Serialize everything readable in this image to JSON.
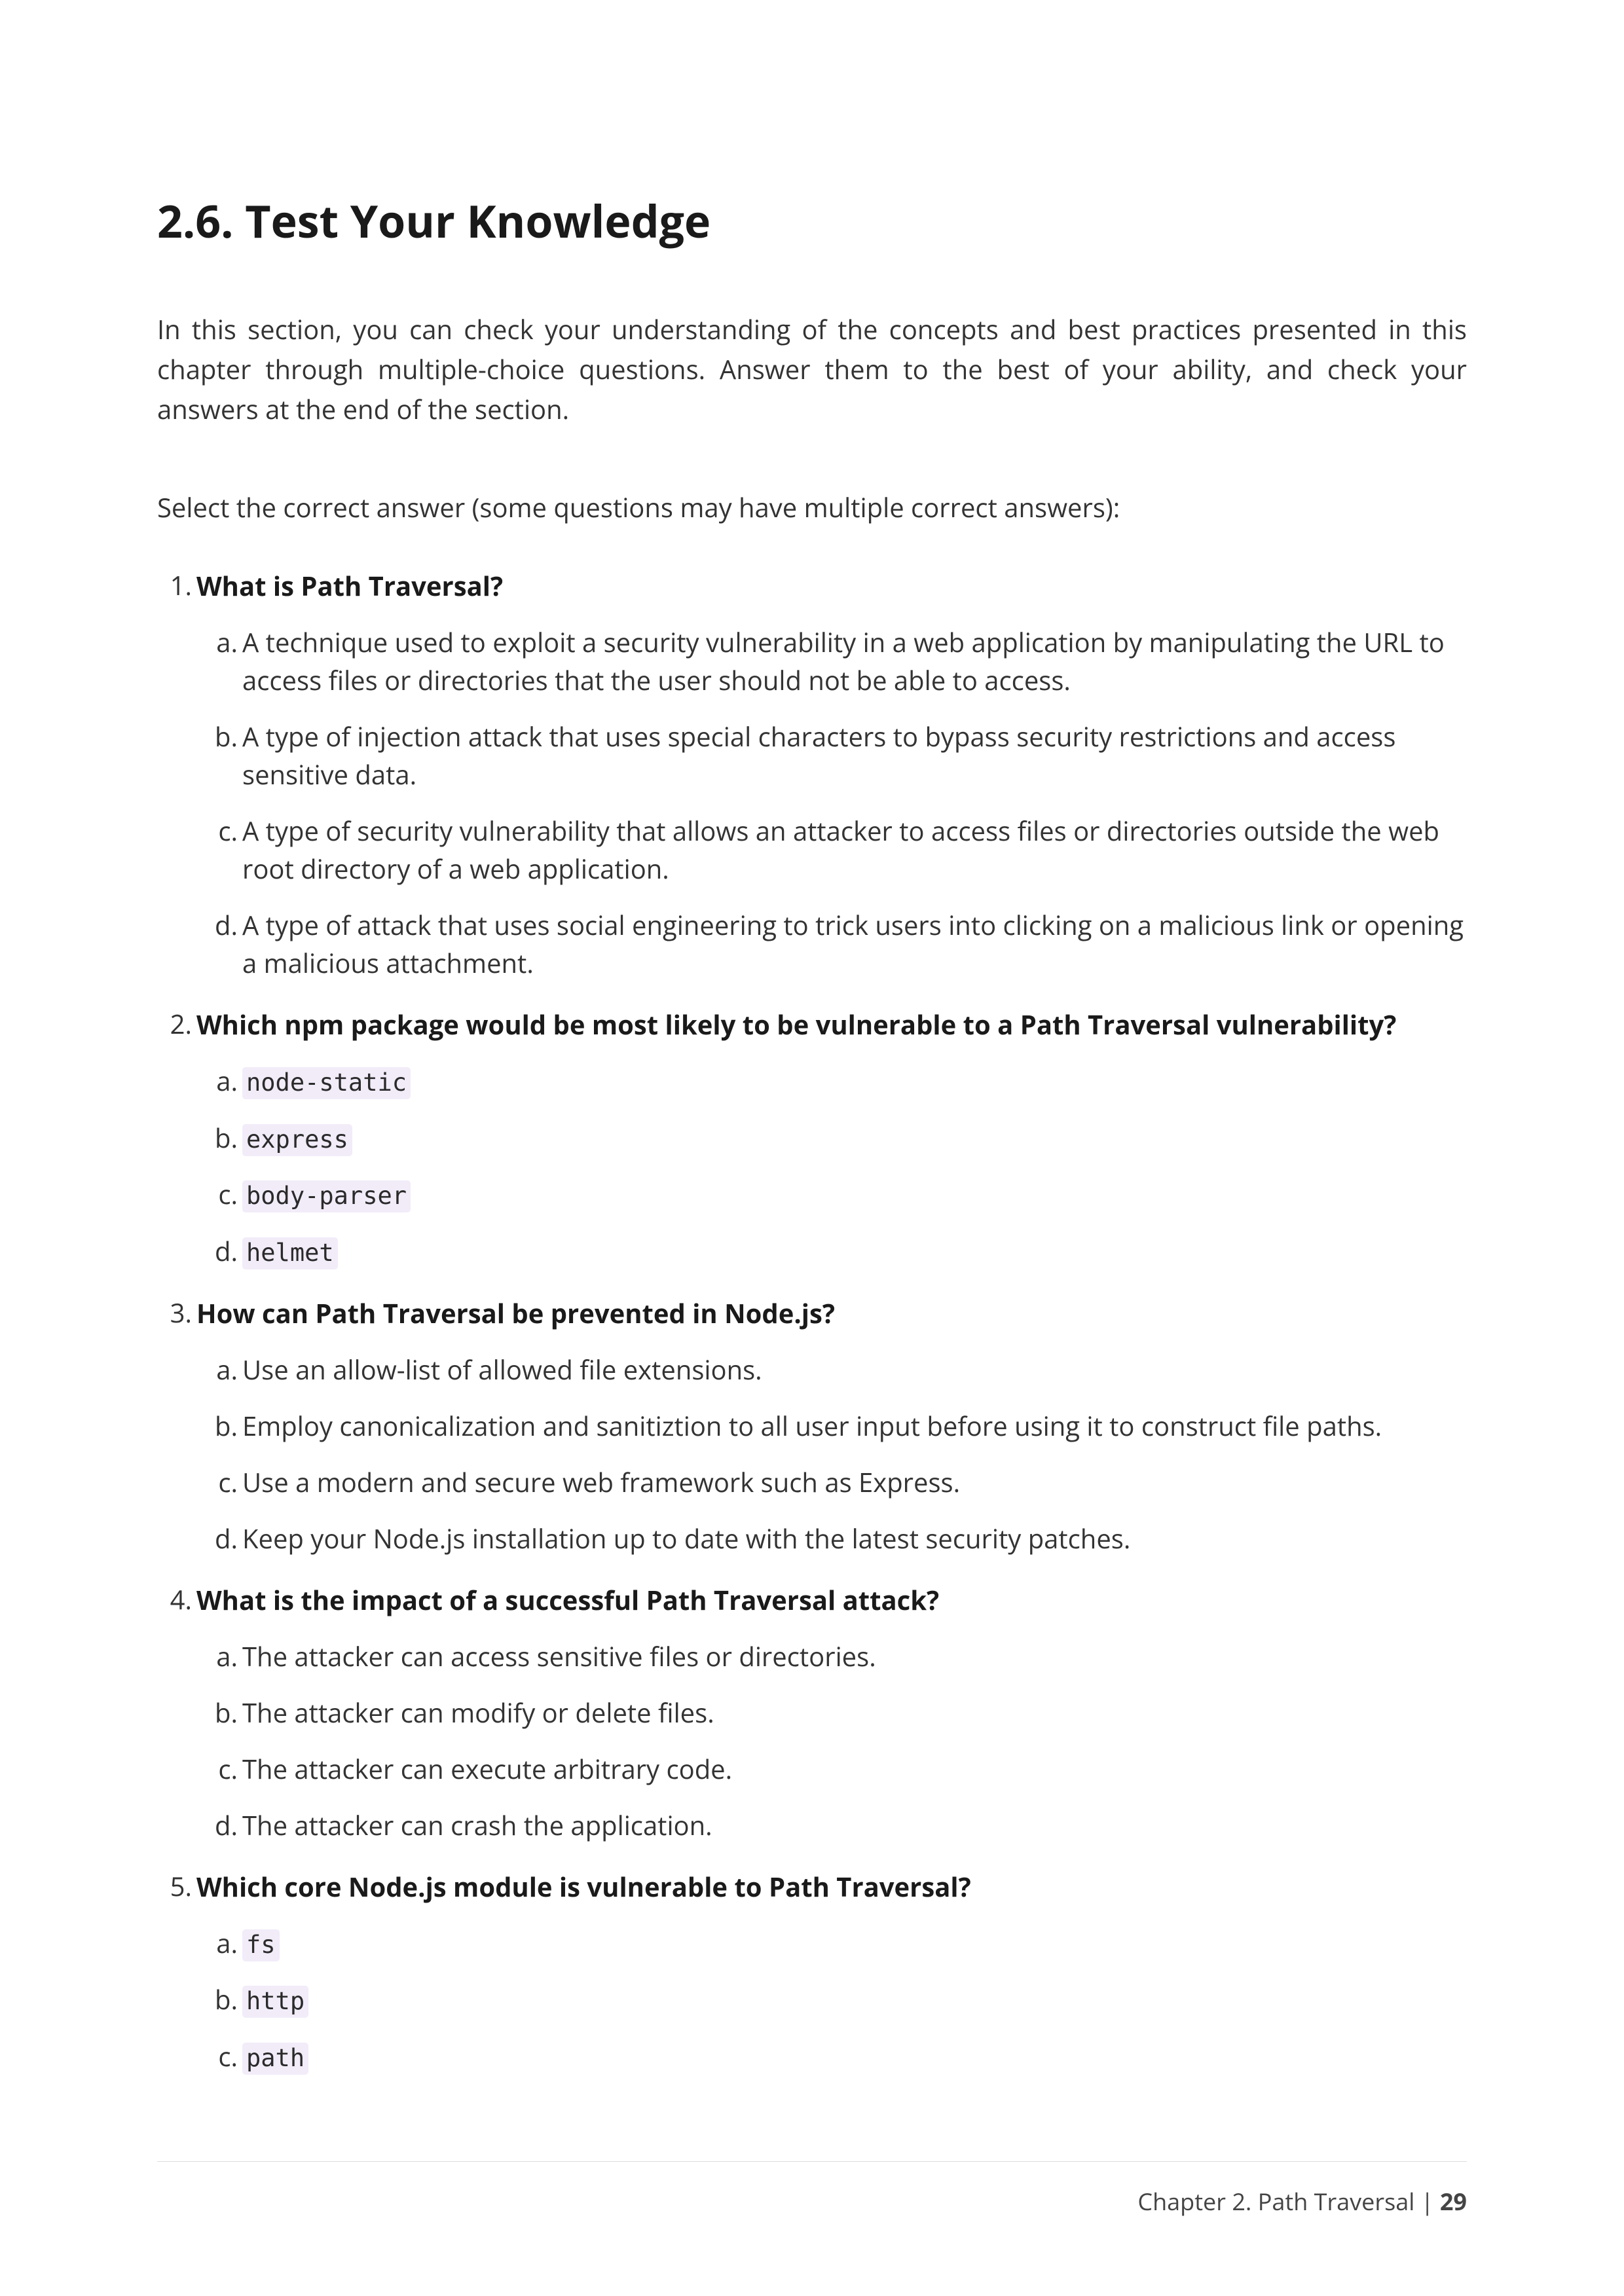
{
  "title": "2.6. Test Your Knowledge",
  "intro": "In this section, you can check your understanding of the concepts and best practices presented in this chapter through multiple-choice questions. Answer them to the best of your ability, and check your answers at the end of the section.",
  "instruction": "Select the correct answer (some questions may have multiple correct answers):",
  "questions": [
    {
      "q": "What is Path Traversal?",
      "answers": [
        {
          "text": "A technique used to exploit a security vulnerability in a web application by manipulating the URL to access files or directories that the user should not be able to access."
        },
        {
          "text": "A type of injection attack that uses special characters to bypass security restrictions and access sensitive data."
        },
        {
          "text": "A type of security vulnerability that allows an attacker to access files or directories outside the web root directory of a web application."
        },
        {
          "text": "A type of attack that uses social engineering to trick users into clicking on a malicious link or opening a malicious attachment."
        }
      ]
    },
    {
      "q": "Which npm package would be most likely to be vulnerable to a Path Traversal vulnerability?",
      "answers": [
        {
          "code": "node-static"
        },
        {
          "code": "express"
        },
        {
          "code": "body-parser"
        },
        {
          "code": "helmet"
        }
      ]
    },
    {
      "q": "How can Path Traversal be prevented in Node.js?",
      "answers": [
        {
          "text": "Use an allow-list of allowed file extensions."
        },
        {
          "text": "Employ canonicalization and sanitiztion to all user input before using it to construct file paths."
        },
        {
          "text": "Use a modern and secure web framework such as Express."
        },
        {
          "text": "Keep your Node.js installation up to date with the latest security patches."
        }
      ]
    },
    {
      "q": "What is the impact of a successful Path Traversal attack?",
      "answers": [
        {
          "text": "The attacker can access sensitive files or directories."
        },
        {
          "text": "The attacker can modify or delete files."
        },
        {
          "text": "The attacker can execute arbitrary code."
        },
        {
          "text": "The attacker can crash the application."
        }
      ]
    },
    {
      "q": "Which core Node.js module is vulnerable to Path Traversal?",
      "answers": [
        {
          "code": "fs"
        },
        {
          "code": "http"
        },
        {
          "code": "path"
        }
      ]
    }
  ],
  "footer": {
    "chapter": "Chapter 2. Path Traversal",
    "separator": " | ",
    "page": "29"
  }
}
